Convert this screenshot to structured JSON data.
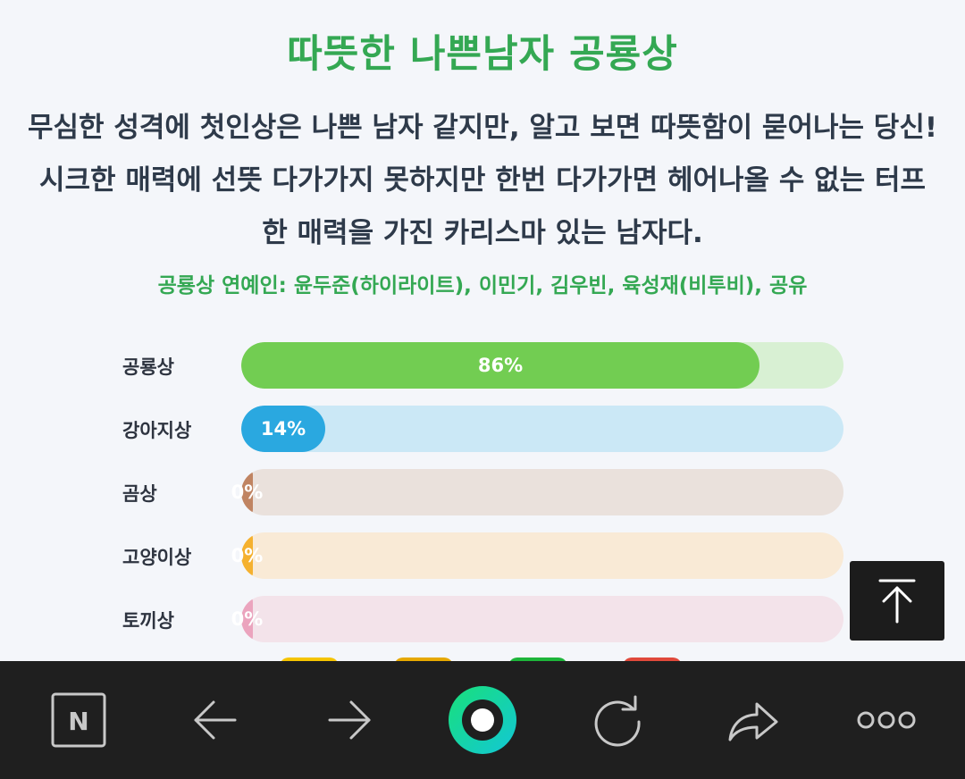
{
  "result": {
    "title": "따뜻한 나쁜남자 공룡상",
    "description": "무심한 성격에 첫인상은 나쁜 남자 같지만, 알고 보면 따뜻함이 묻어나는 당신! 시크한 매력에 선뜻 다가가지 못하지만 한번 다가가면 헤어나올 수 없는 터프한 매력을 가진 카리스마 있는 남자다.",
    "celebrities": "공룡상 연예인: 윤두준(하이라이트), 이민기, 김우빈, 육성재(비투비), 공유"
  },
  "chart_data": {
    "type": "bar",
    "orientation": "horizontal",
    "categories": [
      "공룡상",
      "강아지상",
      "곰상",
      "고양이상",
      "토끼상"
    ],
    "values": [
      86,
      14,
      0,
      0,
      0
    ],
    "value_labels": [
      "86%",
      "14%",
      "0%",
      "0%",
      "0%"
    ],
    "xlim": [
      0,
      100
    ],
    "colors": {
      "fill": [
        "#72cd52",
        "#2aa8e0",
        "#c08462",
        "#f5b12f",
        "#eba4be"
      ],
      "track": [
        "#d8f0d3",
        "#cbe8f6",
        "#eae1dc",
        "#f9ead6",
        "#f3e3ea"
      ]
    }
  },
  "navbar": {
    "items": [
      {
        "name": "naver-home-icon",
        "label": "N"
      },
      {
        "name": "back-arrow-icon"
      },
      {
        "name": "forward-arrow-icon"
      },
      {
        "name": "green-dot-icon"
      },
      {
        "name": "refresh-icon"
      },
      {
        "name": "share-icon"
      },
      {
        "name": "more-icon"
      }
    ]
  },
  "scroll_top": {
    "icon": "arrow-up-to-line-icon"
  }
}
